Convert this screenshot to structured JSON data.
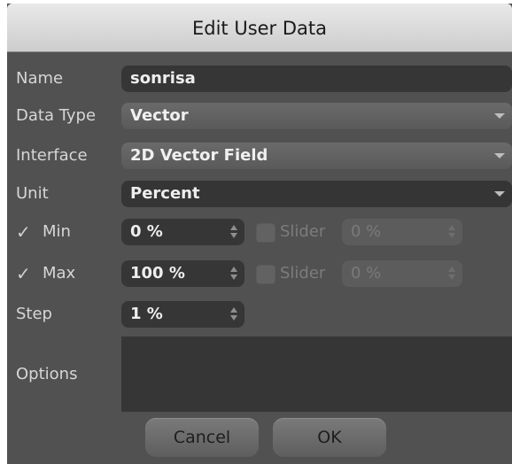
{
  "dialog": {
    "title": "Edit User Data"
  },
  "fields": {
    "name": {
      "label": "Name",
      "value": "sonrisa"
    },
    "data_type": {
      "label": "Data Type",
      "value": "Vector"
    },
    "interface": {
      "label": "Interface",
      "value": "2D Vector Field"
    },
    "unit": {
      "label": "Unit",
      "value": "Percent"
    },
    "min": {
      "label": "Min",
      "checked": true,
      "value": "0 %",
      "slider_label": "Slider",
      "slider_checked": false,
      "slider_value": "0 %"
    },
    "max": {
      "label": "Max",
      "checked": true,
      "value": "100 %",
      "slider_label": "Slider",
      "slider_checked": false,
      "slider_value": "0 %"
    },
    "step": {
      "label": "Step",
      "value": "1 %"
    },
    "options": {
      "label": "Options",
      "value": ""
    }
  },
  "buttons": {
    "cancel": "Cancel",
    "ok": "OK"
  }
}
